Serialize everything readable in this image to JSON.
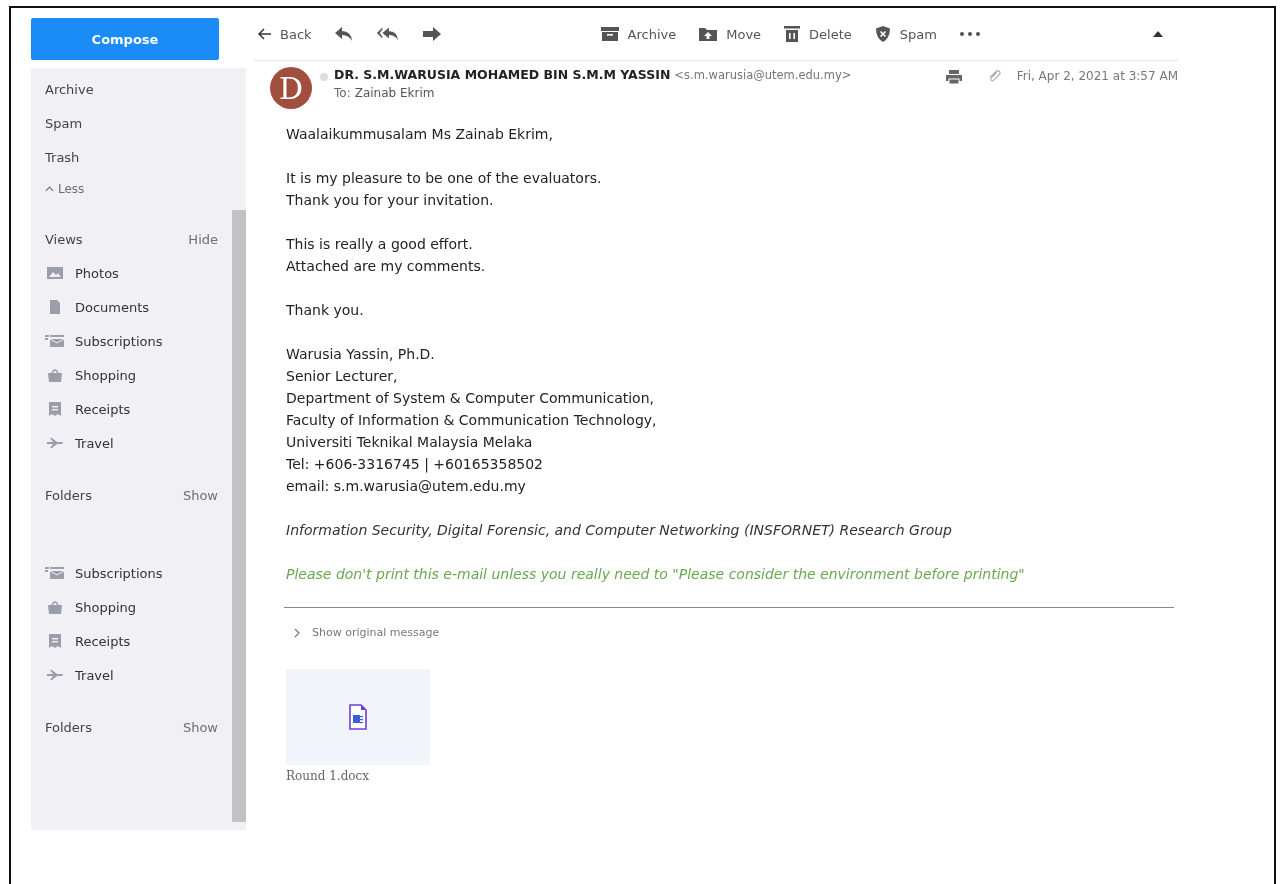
{
  "compose": {
    "label": "Compose"
  },
  "sidebar": {
    "folders": [
      {
        "label": "Archive"
      },
      {
        "label": "Spam"
      },
      {
        "label": "Trash"
      }
    ],
    "less": {
      "label": "Less"
    },
    "groups": [
      {
        "title": "Views",
        "toggle": "Hide",
        "items": [
          {
            "label": "Photos",
            "kind": "photos"
          },
          {
            "label": "Documents",
            "kind": "documents"
          },
          {
            "label": "Subscriptions",
            "kind": "subscriptions"
          },
          {
            "label": "Shopping",
            "kind": "shopping"
          },
          {
            "label": "Receipts",
            "kind": "receipts"
          },
          {
            "label": "Travel",
            "kind": "travel"
          }
        ]
      },
      {
        "title": "Folders",
        "toggle": "Show"
      },
      {
        "items": [
          {
            "label": "Subscriptions",
            "kind": "subscriptions"
          },
          {
            "label": "Shopping",
            "kind": "shopping"
          },
          {
            "label": "Receipts",
            "kind": "receipts"
          },
          {
            "label": "Travel",
            "kind": "travel"
          }
        ]
      },
      {
        "title": "Folders",
        "toggle": "Show"
      }
    ]
  },
  "toolbar": {
    "back": "Back",
    "actions": [
      {
        "label": "Archive",
        "kind": "archive"
      },
      {
        "label": "Move",
        "kind": "move"
      },
      {
        "label": "Delete",
        "kind": "delete"
      },
      {
        "label": "Spam",
        "kind": "spam"
      }
    ]
  },
  "message": {
    "avatar_initial": "D",
    "sender": "DR. S.M.WARUSIA MOHAMED BIN S.M.M YASSIN",
    "sender_email": "<s.m.warusia@utem.edu.my>",
    "to_label": "To:",
    "to": "Zainab Ekrim",
    "date": "Fri, Apr 2, 2021 at 3:57 AM",
    "paragraphs": [
      {
        "kind": "plain",
        "lines": [
          "Waalaikummusalam Ms Zainab Ekrim,"
        ]
      },
      {
        "kind": "plain",
        "lines": [
          "It is my pleasure to be one of the evaluators.",
          "Thank you for your invitation."
        ]
      },
      {
        "kind": "plain",
        "lines": [
          "This is really a good effort.",
          "Attached are my comments."
        ]
      },
      {
        "kind": "plain",
        "lines": [
          "Thank you."
        ]
      },
      {
        "kind": "plain",
        "lines": [
          "Warusia Yassin, Ph.D.",
          "Senior Lecturer,",
          "Department of System & Computer Communication,",
          "Faculty of Information & Communication Technology,",
          "Universiti Teknikal Malaysia Melaka",
          "Tel: +606-3316745 | +60165358502",
          "email: s.m.warusia@utem.edu.my"
        ]
      },
      {
        "kind": "italic",
        "lines": [
          "Information Security, Digital Forensic, and Computer Networking (INSFORNET) Research Group"
        ]
      },
      {
        "kind": "notice",
        "lines": [
          "Please don't print this e-mail unless you really need to \"Please consider the environment before printing\""
        ]
      }
    ],
    "show_original": "Show original message",
    "attachments": [
      {
        "name": "Round 1.docx"
      }
    ]
  }
}
